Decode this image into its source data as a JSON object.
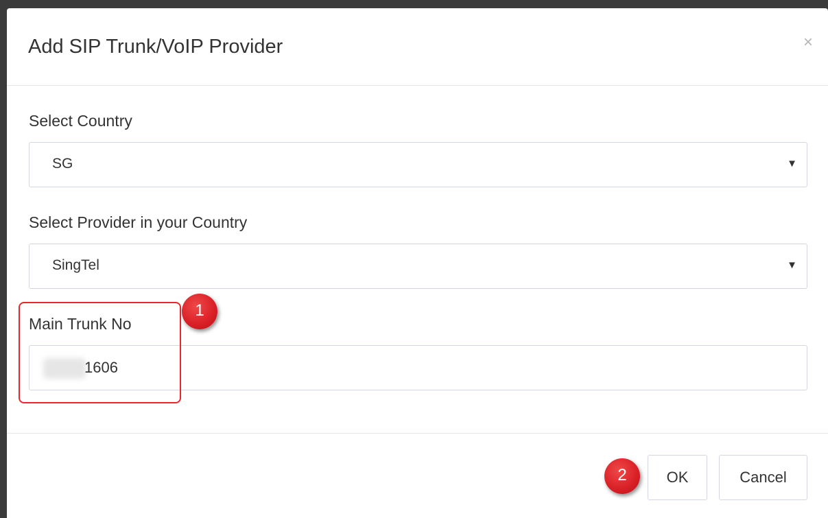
{
  "dialog": {
    "title": "Add SIP Trunk/VoIP Provider",
    "close_symbol": "×"
  },
  "fields": {
    "country": {
      "label": "Select Country",
      "selected_value": "SG",
      "arrow": "▼"
    },
    "provider": {
      "label": "Select Provider in your Country",
      "selected_value": "SingTel",
      "arrow": "▼"
    },
    "main_trunk": {
      "label": "Main Trunk No",
      "value": "1606"
    }
  },
  "footer": {
    "ok_label": "OK",
    "cancel_label": "Cancel"
  },
  "annotations": {
    "step1": "1",
    "step2": "2",
    "highlight_color": "#e8262d",
    "badge_color": "#d81f26"
  },
  "icons": {
    "close": "close-icon",
    "dropdown": "chevron-down-icon"
  }
}
